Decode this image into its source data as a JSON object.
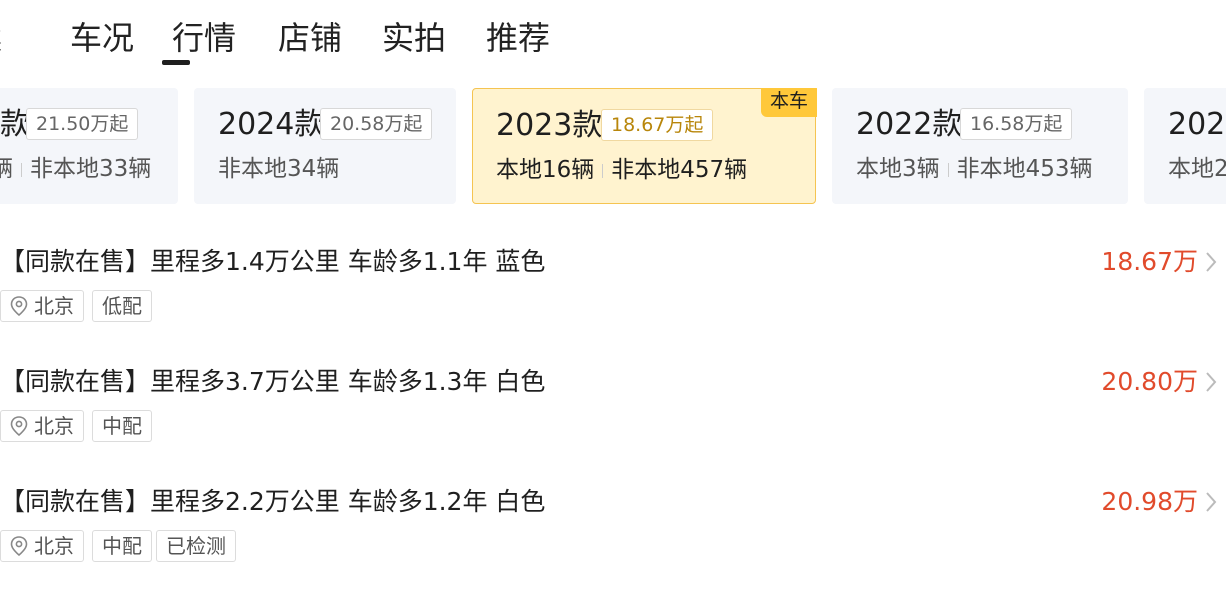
{
  "tabs": [
    {
      "label": "案"
    },
    {
      "label": "车况"
    },
    {
      "label": "行情",
      "active": true
    },
    {
      "label": "店铺"
    },
    {
      "label": "实拍"
    },
    {
      "label": "推荐"
    }
  ],
  "year_cards": [
    {
      "year": "款",
      "price": "21.50万起",
      "stock": "辆",
      "stock2": "非本地33辆"
    },
    {
      "year": "2024款",
      "price": "20.58万起",
      "stock": "非本地34辆"
    },
    {
      "year": "2023款",
      "price": "18.67万起",
      "stock": "本地16辆",
      "stock2": "非本地457辆",
      "badge": "本车",
      "selected": true
    },
    {
      "year": "2022款",
      "price": "16.58万起",
      "stock": "本地3辆",
      "stock2": "非本地453辆"
    },
    {
      "year": "202",
      "stock": "本地2"
    }
  ],
  "listings": [
    {
      "title": "【同款在售】里程多1.4万公里 车龄多1.1年 蓝色",
      "price": "18.67万",
      "city": "北京",
      "tags": [
        "低配"
      ]
    },
    {
      "title": "【同款在售】里程多3.7万公里 车龄多1.3年 白色",
      "price": "20.80万",
      "city": "北京",
      "tags": [
        "中配"
      ]
    },
    {
      "title": "【同款在售】里程多2.2万公里 车龄多1.2年 白色",
      "price": "20.98万",
      "city": "北京",
      "tags": [
        "中配",
        "已检测"
      ]
    }
  ],
  "colors": {
    "accent": "#e14b2c",
    "highlight_bg": "#fff3cf",
    "badge": "#ffc83a"
  }
}
